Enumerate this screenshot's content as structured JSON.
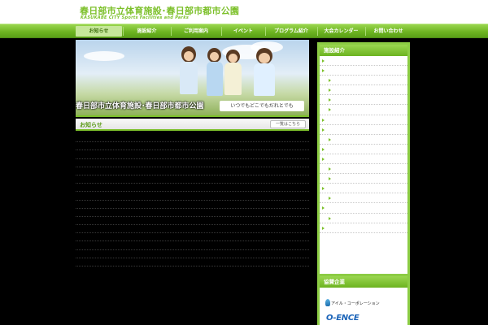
{
  "site": {
    "title": "春日部市立体育施設･春日部市都市公園",
    "subtitle": "KASUKABE CITY Sports Facilities and Parks"
  },
  "nav": {
    "items": [
      {
        "label": "お知らせ",
        "active": true
      },
      {
        "label": "施設紹介",
        "active": false
      },
      {
        "label": "ご利用案内",
        "active": false
      },
      {
        "label": "イベント",
        "active": false
      },
      {
        "label": "プログラム紹介",
        "active": false
      },
      {
        "label": "大会カレンダー",
        "active": false
      },
      {
        "label": "お問い合わせ",
        "active": false
      }
    ]
  },
  "hero": {
    "caption": "春日部市立体育施設･春日部市都市公園",
    "tagline": "いつでもどこでもだれとでも"
  },
  "news": {
    "title": "お知らせ",
    "more_label": "一覧はこちら",
    "items": [
      {
        "date": "",
        "title": ""
      },
      {
        "date": "",
        "title": ""
      },
      {
        "date": "",
        "title": ""
      },
      {
        "date": "",
        "title": ""
      },
      {
        "date": "",
        "title": ""
      },
      {
        "date": "",
        "title": ""
      },
      {
        "date": "",
        "title": ""
      },
      {
        "date": "",
        "title": ""
      },
      {
        "date": "",
        "title": ""
      },
      {
        "date": "",
        "title": ""
      },
      {
        "date": "",
        "title": ""
      },
      {
        "date": "",
        "title": ""
      },
      {
        "date": "",
        "title": ""
      },
      {
        "date": "",
        "title": ""
      },
      {
        "date": "",
        "title": ""
      },
      {
        "date": "",
        "title": ""
      }
    ]
  },
  "sidebar": {
    "title": "施設紹介",
    "items": [
      {
        "label": "",
        "sub": false
      },
      {
        "label": "",
        "sub": false
      },
      {
        "label": "",
        "sub": true
      },
      {
        "label": "",
        "sub": true
      },
      {
        "label": "",
        "sub": true
      },
      {
        "label": "",
        "sub": true
      },
      {
        "label": "",
        "sub": false
      },
      {
        "label": "",
        "sub": false
      },
      {
        "label": "",
        "sub": true
      },
      {
        "label": "",
        "sub": false
      },
      {
        "label": "",
        "sub": false
      },
      {
        "label": "",
        "sub": true
      },
      {
        "label": "",
        "sub": true
      },
      {
        "label": "",
        "sub": false
      },
      {
        "label": "",
        "sub": true
      },
      {
        "label": "",
        "sub": false
      },
      {
        "label": "",
        "sub": true
      },
      {
        "label": "",
        "sub": false
      }
    ]
  },
  "sponsors": {
    "title": "協賛企業",
    "items": [
      {
        "label": "アイル・コーポレーション"
      },
      {
        "label": "O-ENCE"
      }
    ]
  },
  "colors": {
    "accent": "#7cc02a",
    "link": "#3f5fff",
    "background": "#000000"
  }
}
